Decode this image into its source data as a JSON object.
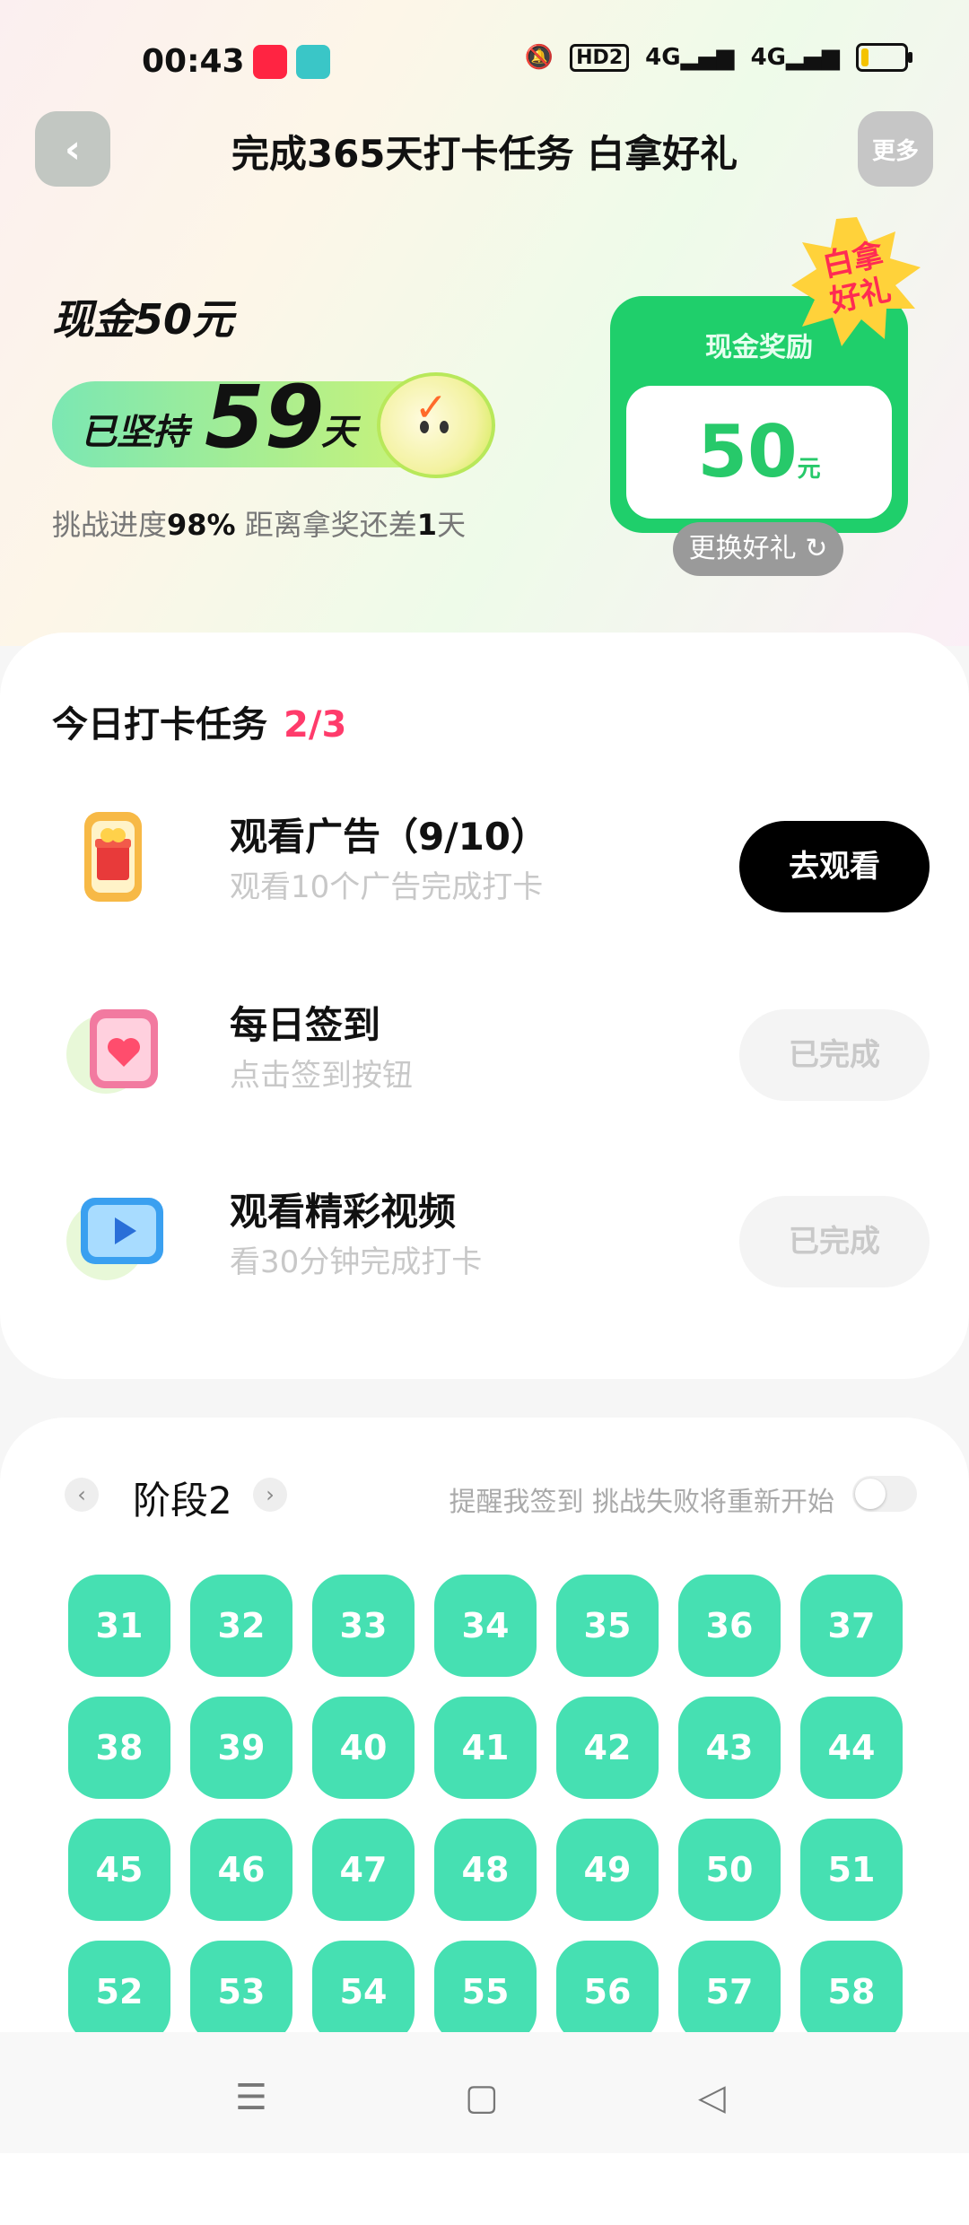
{
  "status_bar": {
    "time": "00:43",
    "app_icon_1_text": "小红书",
    "signal_1": "4G",
    "signal_2": "4G",
    "hd": "HD2"
  },
  "nav": {
    "back_icon": "chevron-left-icon",
    "title": "完成365天打卡任务 白拿好礼",
    "more_label": "更多"
  },
  "hero": {
    "cash_title": "现金50元",
    "streak_prefix": "已坚持",
    "streak_days": "59",
    "streak_suffix": "天",
    "progress_text_1": "挑战进度",
    "progress_value": "98%",
    "progress_text_2": " 距离拿奖还差",
    "days_left": "1",
    "days_left_unit": "天"
  },
  "reward": {
    "label": "现金奖励",
    "amount": "50",
    "unit": "元",
    "badge_line1": "白拿",
    "badge_line2": "好礼",
    "change_label": "更换好礼"
  },
  "tasks": {
    "heading": "今日打卡任务",
    "count": "2/3",
    "items": [
      {
        "name": "观看广告（9/10）",
        "desc": "观看10个广告完成打卡",
        "button": "去观看",
        "icon": "gift-box-icon"
      },
      {
        "name": "每日签到",
        "desc": "点击签到按钮",
        "button": "已完成",
        "icon": "heart-calendar-icon"
      },
      {
        "name": "观看精彩视频",
        "desc": "看30分钟完成打卡",
        "button": "已完成",
        "icon": "video-play-icon"
      }
    ]
  },
  "stage": {
    "label": "阶段2",
    "remind": "提醒我签到 挑战失败将重新开始",
    "toggle_on": false,
    "days": [
      "31",
      "32",
      "33",
      "34",
      "35",
      "36",
      "37",
      "38",
      "39",
      "40",
      "41",
      "42",
      "43",
      "44",
      "45",
      "46",
      "47",
      "48",
      "49",
      "50",
      "51",
      "52",
      "53",
      "54",
      "55",
      "56",
      "57",
      "58"
    ]
  },
  "navbar": {
    "menu_icon": "menu-icon",
    "home_icon": "home-square-icon",
    "back_icon": "back-triangle-icon"
  },
  "colors": {
    "accent_green": "#1fcf6b",
    "day_tile": "#46e0b2",
    "count_pink": "#ff3b6b"
  }
}
